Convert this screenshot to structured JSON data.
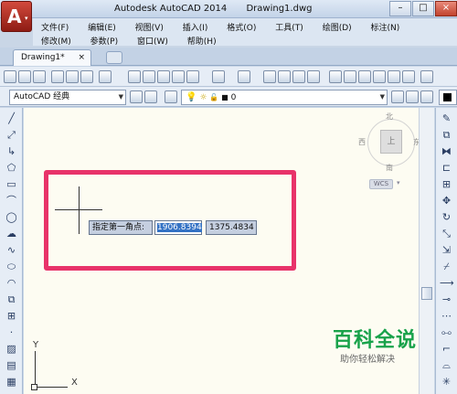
{
  "titlebar": {
    "app_name": "Autodesk AutoCAD 2014",
    "file_name": "Drawing1.dwg",
    "minimize": "–",
    "maximize": "□",
    "close": "×"
  },
  "app_button": {
    "letter": "A",
    "arrow": "▾"
  },
  "menu": {
    "row1": [
      "文件(F)",
      "编辑(E)",
      "视图(V)",
      "插入(I)",
      "格式(O)",
      "工具(T)",
      "绘图(D)",
      "标注(N)"
    ],
    "row2": [
      "修改(M)",
      "参数(P)",
      "窗口(W)",
      "帮助(H)"
    ]
  },
  "tabs": {
    "active_tab": "Drawing1*",
    "close": "×"
  },
  "toolbar2": {
    "workspace": "AutoCAD 经典",
    "layer_value": "0"
  },
  "viewcube": {
    "north": "北",
    "south": "南",
    "east": "东",
    "west": "西",
    "top_face": "上",
    "ucs": "WCS",
    "ucs_arrow": "▾"
  },
  "dynamic_input": {
    "prompt": "指定第一角点:",
    "x_value": "1906.8394",
    "y_value": "1375.4834"
  },
  "ucs_icon": {
    "x_label": "X",
    "y_label": "Y"
  },
  "watermark": {
    "title": "百科全说",
    "subtitle": "助你轻松解决"
  },
  "colors": {
    "highlight": "#e8336a",
    "watermark_green": "#18a24a",
    "canvas": "#fdfcf2"
  }
}
